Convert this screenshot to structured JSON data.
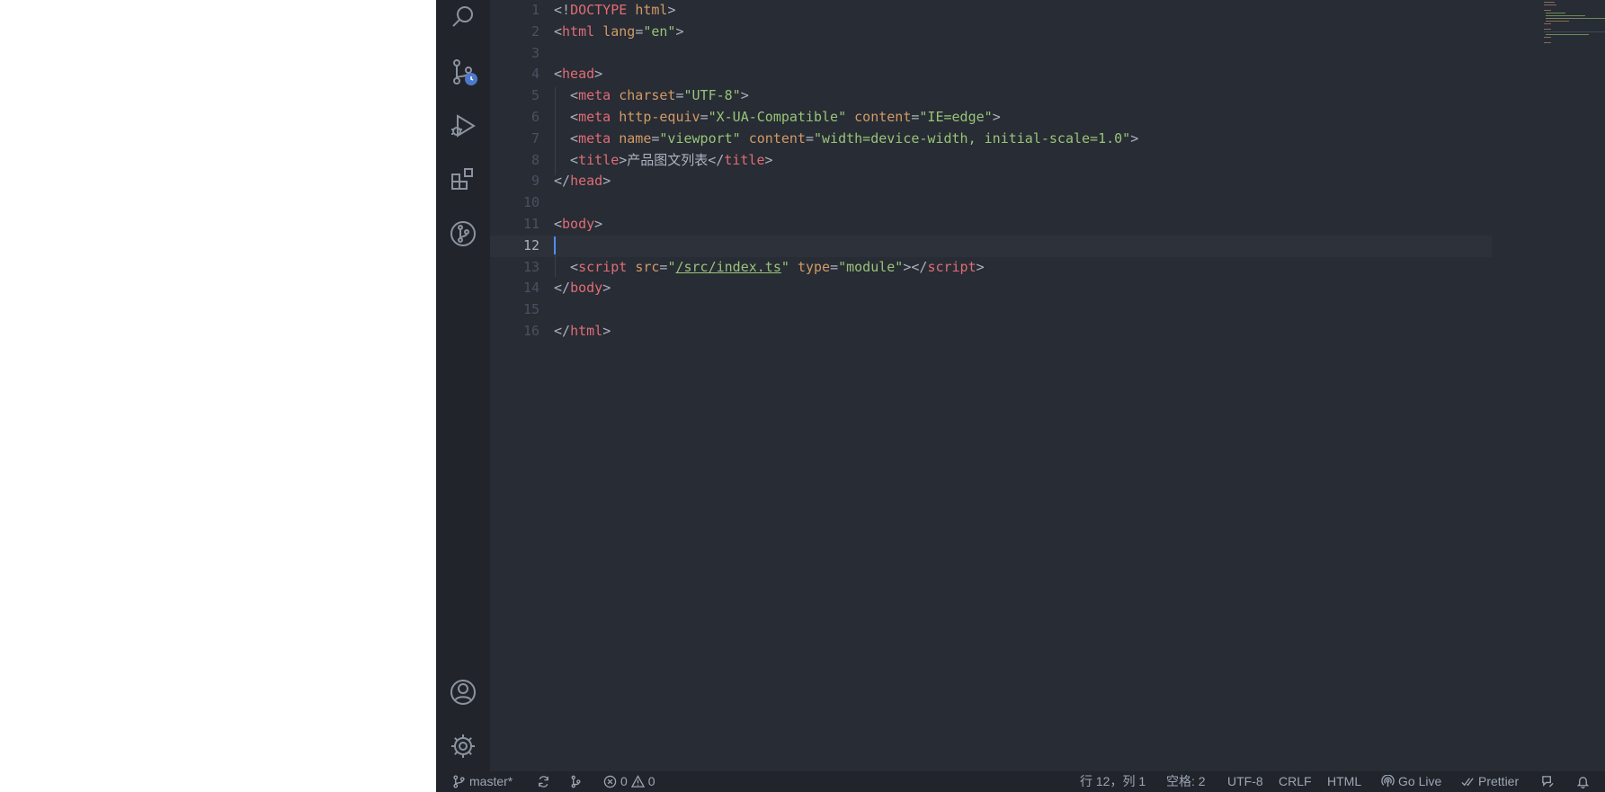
{
  "editor": {
    "active_line": 12,
    "lines": [
      {
        "n": "1",
        "tokens": [
          {
            "t": "<!",
            "c": "punc"
          },
          {
            "t": "DOCTYPE",
            "c": "tag"
          },
          {
            "t": " ",
            "c": "punc"
          },
          {
            "t": "html",
            "c": "attr"
          },
          {
            "t": ">",
            "c": "punc"
          }
        ]
      },
      {
        "n": "2",
        "tokens": [
          {
            "t": "<",
            "c": "punc"
          },
          {
            "t": "html",
            "c": "tag"
          },
          {
            "t": " ",
            "c": "punc"
          },
          {
            "t": "lang",
            "c": "attr"
          },
          {
            "t": "=",
            "c": "punc"
          },
          {
            "t": "\"en\"",
            "c": "str"
          },
          {
            "t": ">",
            "c": "punc"
          }
        ]
      },
      {
        "n": "3",
        "tokens": []
      },
      {
        "n": "4",
        "tokens": [
          {
            "t": "<",
            "c": "punc"
          },
          {
            "t": "head",
            "c": "tag"
          },
          {
            "t": ">",
            "c": "punc"
          }
        ]
      },
      {
        "n": "5",
        "tokens": [
          {
            "t": "  <",
            "c": "punc"
          },
          {
            "t": "meta",
            "c": "tag"
          },
          {
            "t": " ",
            "c": "punc"
          },
          {
            "t": "charset",
            "c": "attr"
          },
          {
            "t": "=",
            "c": "punc"
          },
          {
            "t": "\"UTF-8\"",
            "c": "str"
          },
          {
            "t": ">",
            "c": "punc"
          }
        ]
      },
      {
        "n": "6",
        "tokens": [
          {
            "t": "  <",
            "c": "punc"
          },
          {
            "t": "meta",
            "c": "tag"
          },
          {
            "t": " ",
            "c": "punc"
          },
          {
            "t": "http-equiv",
            "c": "attr"
          },
          {
            "t": "=",
            "c": "punc"
          },
          {
            "t": "\"X-UA-Compatible\"",
            "c": "str"
          },
          {
            "t": " ",
            "c": "punc"
          },
          {
            "t": "content",
            "c": "attr"
          },
          {
            "t": "=",
            "c": "punc"
          },
          {
            "t": "\"IE=edge\"",
            "c": "str"
          },
          {
            "t": ">",
            "c": "punc"
          }
        ]
      },
      {
        "n": "7",
        "tokens": [
          {
            "t": "  <",
            "c": "punc"
          },
          {
            "t": "meta",
            "c": "tag"
          },
          {
            "t": " ",
            "c": "punc"
          },
          {
            "t": "name",
            "c": "attr"
          },
          {
            "t": "=",
            "c": "punc"
          },
          {
            "t": "\"viewport\"",
            "c": "str"
          },
          {
            "t": " ",
            "c": "punc"
          },
          {
            "t": "content",
            "c": "attr"
          },
          {
            "t": "=",
            "c": "punc"
          },
          {
            "t": "\"width=device-width, initial-scale=1.0\"",
            "c": "str"
          },
          {
            "t": ">",
            "c": "punc"
          }
        ]
      },
      {
        "n": "8",
        "tokens": [
          {
            "t": "  <",
            "c": "punc"
          },
          {
            "t": "title",
            "c": "tag"
          },
          {
            "t": ">产品图文列表</",
            "c": "punc"
          },
          {
            "t": "title",
            "c": "tag"
          },
          {
            "t": ">",
            "c": "punc"
          }
        ]
      },
      {
        "n": "9",
        "tokens": [
          {
            "t": "</",
            "c": "punc"
          },
          {
            "t": "head",
            "c": "tag"
          },
          {
            "t": ">",
            "c": "punc"
          }
        ]
      },
      {
        "n": "10",
        "tokens": []
      },
      {
        "n": "11",
        "tokens": [
          {
            "t": "<",
            "c": "punc"
          },
          {
            "t": "body",
            "c": "tag"
          },
          {
            "t": ">",
            "c": "punc"
          }
        ]
      },
      {
        "n": "12",
        "tokens": []
      },
      {
        "n": "13",
        "tokens": [
          {
            "t": "  <",
            "c": "punc"
          },
          {
            "t": "script",
            "c": "tag"
          },
          {
            "t": " ",
            "c": "punc"
          },
          {
            "t": "src",
            "c": "attr"
          },
          {
            "t": "=",
            "c": "punc"
          },
          {
            "t": "\"",
            "c": "str"
          },
          {
            "t": "/src/index.ts",
            "c": "str link"
          },
          {
            "t": "\"",
            "c": "str"
          },
          {
            "t": " ",
            "c": "punc"
          },
          {
            "t": "type",
            "c": "attr"
          },
          {
            "t": "=",
            "c": "punc"
          },
          {
            "t": "\"module\"",
            "c": "str"
          },
          {
            "t": "></",
            "c": "punc"
          },
          {
            "t": "script",
            "c": "tag"
          },
          {
            "t": ">",
            "c": "punc"
          }
        ]
      },
      {
        "n": "14",
        "tokens": [
          {
            "t": "</",
            "c": "punc"
          },
          {
            "t": "body",
            "c": "tag"
          },
          {
            "t": ">",
            "c": "punc"
          }
        ]
      },
      {
        "n": "15",
        "tokens": []
      },
      {
        "n": "16",
        "tokens": [
          {
            "t": "</",
            "c": "punc"
          },
          {
            "t": "html",
            "c": "tag"
          },
          {
            "t": ">",
            "c": "punc"
          }
        ]
      }
    ]
  },
  "activity_bar": {
    "top": [
      {
        "name": "search-icon"
      },
      {
        "name": "source-control-icon"
      },
      {
        "name": "run-debug-icon"
      },
      {
        "name": "extensions-icon"
      },
      {
        "name": "git-graph-icon"
      }
    ],
    "bottom": [
      {
        "name": "account-icon"
      },
      {
        "name": "settings-gear-icon"
      }
    ]
  },
  "status_bar": {
    "branch": "master*",
    "errors": "0",
    "warnings": "0",
    "position": "行 12，列 1",
    "spaces": "空格: 2",
    "encoding": "UTF-8",
    "eol": "CRLF",
    "language": "HTML",
    "go_live": "Go Live",
    "prettier": "Prettier"
  },
  "theme": {
    "editor_bg": "#282c34",
    "sidebar_bg": "#21252b",
    "tag": "#e06c75",
    "attr": "#d19a66",
    "string": "#98c379",
    "text": "#abb2bf",
    "cursor": "#528bff"
  }
}
